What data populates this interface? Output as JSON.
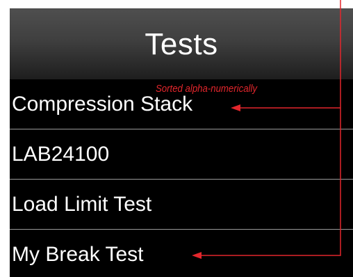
{
  "header": {
    "title": "Tests"
  },
  "tests": {
    "items": [
      {
        "label": "Compression Stack"
      },
      {
        "label": "LAB24100"
      },
      {
        "label": "Load Limit Test"
      },
      {
        "label": "My Break Test"
      }
    ]
  },
  "annotation": {
    "text": "Sorted alpha-numerically",
    "color": "#e3262c"
  }
}
